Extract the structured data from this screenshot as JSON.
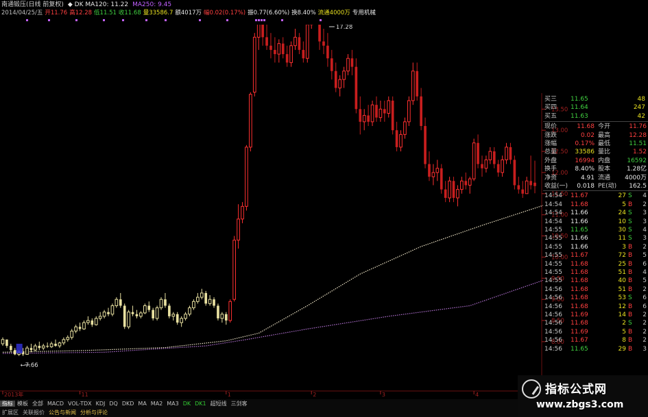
{
  "header": {
    "title_parts": [
      {
        "text": "南通锻压(日线 前复权)",
        "color": "#d0d0d0"
      },
      {
        "text": "◆ DK  MA120: 11.22",
        "color": "#e8e8e8"
      },
      {
        "text": "MA250: 9.45",
        "color": "#c060ff"
      }
    ],
    "quote_parts": [
      {
        "text": "2014/04/25/五",
        "color": "#c0c0c0"
      },
      {
        "text": "开11.76",
        "color": "#ff4040"
      },
      {
        "text": "高12.28",
        "color": "#ff4040"
      },
      {
        "text": "低11.51",
        "color": "#40d040"
      },
      {
        "text": "收11.68",
        "color": "#40d040"
      },
      {
        "text": "量33586.7",
        "color": "#e8e020"
      },
      {
        "text": "额4017万",
        "color": "#e8e8e8"
      },
      {
        "text": "幅0.02(0.17%)",
        "color": "#ff4040"
      },
      {
        "text": "振0.77(6.60%)",
        "color": "#e8e8e8"
      },
      {
        "text": "换8.40%",
        "color": "#e8e8e8"
      },
      {
        "text": "流通4000万",
        "color": "#e8e020"
      },
      {
        "text": "专用机械",
        "color": "#e8e8e8"
      }
    ]
  },
  "chart_data": {
    "type": "candlestick",
    "title": "南通锻压(日线 前复权)",
    "ylim": [
      7.4,
      15.4
    ],
    "y_ticks": [
      "15.00",
      "14.50",
      "14.00",
      "13.50",
      "13.00",
      "12.50",
      "12.00",
      "11.50",
      "11.00",
      "10.50",
      "10.00",
      "9.50",
      "9.00",
      "8.50",
      "8.00"
    ],
    "x_ticks": [
      {
        "label": "2013年",
        "idx": 0
      },
      {
        "label": "11",
        "idx": 19
      },
      {
        "label": "1",
        "idx": 55
      },
      {
        "label": "2",
        "idx": 76
      },
      {
        "label": "3",
        "idx": 93
      },
      {
        "label": "4",
        "idx": 116
      }
    ],
    "annotations": [
      {
        "text": "17.28",
        "idx": 80,
        "value": 15.4
      },
      {
        "text": "7.66",
        "idx": 5,
        "value": 7.66
      }
    ],
    "ma_series": [
      {
        "name": "MA120",
        "color": "#f0e6c8",
        "points": [
          [
            0,
            7.75
          ],
          [
            20,
            7.79
          ],
          [
            40,
            7.86
          ],
          [
            55,
            8.02
          ],
          [
            63,
            8.2
          ],
          [
            75,
            8.85
          ],
          [
            88,
            9.6
          ],
          [
            103,
            10.25
          ],
          [
            118,
            10.75
          ],
          [
            133,
            11.22
          ]
        ]
      },
      {
        "name": "MA250",
        "color": "#b070d0",
        "points": [
          [
            0,
            7.72
          ],
          [
            25,
            7.75
          ],
          [
            50,
            7.9
          ],
          [
            60,
            8.05
          ],
          [
            75,
            8.3
          ],
          [
            95,
            8.6
          ],
          [
            115,
            8.85
          ],
          [
            133,
            9.45
          ]
        ]
      }
    ],
    "candles": [
      [
        7.95,
        8.1,
        7.9,
        8.05
      ],
      [
        8.05,
        8.05,
        7.85,
        7.9
      ],
      [
        7.9,
        7.95,
        7.75,
        7.8
      ],
      [
        7.8,
        7.85,
        7.68,
        7.7
      ],
      [
        7.7,
        7.8,
        7.66,
        7.75
      ],
      [
        7.75,
        7.85,
        7.66,
        7.7
      ],
      [
        7.7,
        7.9,
        7.7,
        7.85
      ],
      [
        7.85,
        7.95,
        7.75,
        7.8
      ],
      [
        7.8,
        7.95,
        7.78,
        7.9
      ],
      [
        7.9,
        8.0,
        7.8,
        7.85
      ],
      [
        7.85,
        7.95,
        7.8,
        7.9
      ],
      [
        7.9,
        7.98,
        7.85,
        7.88
      ],
      [
        7.88,
        8.0,
        7.85,
        7.95
      ],
      [
        7.95,
        8.05,
        7.88,
        7.9
      ],
      [
        7.9,
        8.0,
        7.85,
        7.97
      ],
      [
        7.97,
        8.1,
        7.92,
        8.05
      ],
      [
        8.05,
        8.15,
        8.0,
        8.1
      ],
      [
        8.1,
        8.3,
        8.05,
        8.25
      ],
      [
        8.25,
        8.4,
        8.2,
        8.35
      ],
      [
        8.35,
        8.45,
        8.25,
        8.3
      ],
      [
        8.3,
        8.5,
        8.28,
        8.45
      ],
      [
        8.45,
        8.6,
        8.4,
        8.5
      ],
      [
        8.5,
        8.55,
        8.35,
        8.4
      ],
      [
        8.4,
        8.6,
        8.38,
        8.55
      ],
      [
        8.55,
        8.7,
        8.5,
        8.6
      ],
      [
        8.6,
        8.75,
        8.55,
        8.7
      ],
      [
        8.7,
        8.8,
        8.6,
        8.65
      ],
      [
        8.65,
        8.9,
        8.6,
        8.85
      ],
      [
        8.85,
        9.05,
        8.8,
        9.0
      ],
      [
        9.0,
        9.15,
        8.8,
        8.85
      ],
      [
        8.85,
        8.9,
        8.3,
        8.35
      ],
      [
        8.35,
        8.75,
        8.3,
        8.7
      ],
      [
        8.7,
        8.85,
        8.6,
        8.65
      ],
      [
        8.65,
        8.75,
        8.55,
        8.6
      ],
      [
        8.6,
        8.72,
        8.55,
        8.68
      ],
      [
        8.68,
        8.9,
        8.65,
        8.85
      ],
      [
        8.85,
        8.95,
        8.7,
        8.75
      ],
      [
        8.75,
        8.8,
        8.5,
        8.55
      ],
      [
        8.55,
        8.85,
        8.5,
        8.8
      ],
      [
        8.8,
        9.05,
        8.75,
        9.0
      ],
      [
        9.0,
        9.15,
        8.8,
        8.85
      ],
      [
        8.85,
        8.9,
        8.55,
        8.6
      ],
      [
        8.6,
        8.7,
        8.5,
        8.65
      ],
      [
        8.65,
        8.7,
        8.4,
        8.45
      ],
      [
        8.45,
        8.6,
        8.35,
        8.55
      ],
      [
        8.55,
        8.7,
        8.5,
        8.65
      ],
      [
        8.65,
        8.85,
        8.6,
        8.8
      ],
      [
        8.8,
        9.0,
        8.75,
        8.95
      ],
      [
        8.95,
        9.15,
        8.9,
        9.05
      ],
      [
        9.05,
        9.25,
        9.0,
        9.15
      ],
      [
        9.15,
        9.2,
        8.85,
        8.9
      ],
      [
        8.9,
        9.1,
        8.85,
        9.0
      ],
      [
        9.0,
        9.05,
        8.8,
        8.85
      ],
      [
        8.85,
        8.9,
        8.5,
        8.55
      ],
      [
        8.55,
        8.7,
        8.45,
        8.65
      ],
      [
        8.65,
        8.7,
        8.4,
        8.5
      ],
      [
        8.5,
        9.0,
        8.45,
        8.95
      ],
      [
        9.0,
        10.5,
        8.95,
        10.4
      ],
      [
        10.4,
        11.25,
        10.2,
        10.9
      ],
      [
        10.9,
        11.3,
        10.8,
        11.2
      ],
      [
        11.2,
        12.65,
        11.1,
        12.6
      ],
      [
        12.6,
        13.9,
        12.5,
        13.85
      ],
      [
        13.9,
        15.3,
        13.8,
        15.2
      ],
      [
        15.2,
        16.1,
        14.9,
        15.6
      ],
      [
        15.6,
        15.9,
        15.0,
        15.2
      ],
      [
        15.2,
        15.5,
        14.9,
        15.0
      ],
      [
        15.0,
        15.3,
        14.7,
        14.9
      ],
      [
        14.9,
        15.2,
        14.6,
        14.8
      ],
      [
        14.8,
        15.15,
        14.6,
        15.05
      ],
      [
        15.05,
        15.2,
        14.7,
        14.8
      ],
      [
        14.8,
        15.0,
        14.5,
        14.6
      ],
      [
        14.6,
        15.1,
        14.5,
        15.0
      ],
      [
        15.0,
        15.4,
        14.9,
        15.2
      ],
      [
        15.2,
        15.3,
        14.8,
        14.9
      ],
      [
        14.9,
        15.1,
        14.6,
        14.7
      ],
      [
        14.7,
        15.6,
        14.6,
        15.5
      ],
      [
        15.5,
        17.28,
        15.4,
        17.0
      ],
      [
        17.0,
        17.2,
        16.0,
        16.2
      ],
      [
        16.2,
        16.4,
        14.9,
        15.1
      ],
      [
        15.1,
        15.4,
        14.8,
        15.0
      ],
      [
        15.0,
        15.3,
        14.5,
        14.7
      ],
      [
        14.7,
        14.9,
        14.2,
        14.4
      ],
      [
        14.4,
        14.6,
        13.9,
        14.0
      ],
      [
        14.0,
        14.3,
        13.8,
        14.2
      ],
      [
        14.2,
        14.5,
        14.0,
        14.4
      ],
      [
        14.4,
        14.8,
        14.3,
        14.7
      ],
      [
        14.7,
        14.9,
        14.3,
        14.5
      ],
      [
        14.5,
        14.7,
        13.4,
        13.5
      ],
      [
        13.5,
        13.8,
        12.9,
        13.2
      ],
      [
        13.2,
        13.5,
        13.0,
        13.35
      ],
      [
        13.35,
        13.6,
        13.1,
        13.2
      ],
      [
        13.2,
        13.7,
        13.1,
        13.6
      ],
      [
        13.6,
        13.8,
        13.2,
        13.3
      ],
      [
        13.3,
        13.7,
        13.2,
        13.5
      ],
      [
        13.5,
        13.7,
        13.2,
        13.4
      ],
      [
        13.4,
        13.8,
        13.3,
        13.7
      ],
      [
        13.7,
        13.8,
        12.9,
        13.0
      ],
      [
        13.0,
        13.2,
        12.5,
        12.6
      ],
      [
        12.6,
        13.0,
        12.5,
        12.9
      ],
      [
        12.9,
        13.3,
        12.8,
        13.2
      ],
      [
        13.2,
        13.8,
        13.1,
        13.7
      ],
      [
        13.7,
        14.6,
        13.6,
        14.4
      ],
      [
        14.4,
        14.6,
        13.7,
        13.8
      ],
      [
        13.8,
        14.0,
        13.0,
        13.1
      ],
      [
        13.1,
        13.3,
        12.1,
        12.2
      ],
      [
        12.2,
        12.5,
        11.8,
        11.9
      ],
      [
        11.9,
        12.2,
        11.7,
        12.0
      ],
      [
        12.0,
        12.3,
        11.8,
        12.1
      ],
      [
        12.1,
        12.2,
        11.5,
        11.6
      ],
      [
        11.6,
        11.8,
        11.3,
        11.4
      ],
      [
        11.4,
        11.9,
        11.3,
        11.8
      ],
      [
        11.8,
        11.9,
        11.3,
        11.4
      ],
      [
        11.4,
        11.7,
        11.2,
        11.6
      ],
      [
        11.6,
        11.9,
        11.5,
        11.8
      ],
      [
        11.8,
        12.0,
        11.6,
        11.7
      ],
      [
        11.7,
        11.9,
        11.5,
        11.85
      ],
      [
        11.85,
        12.8,
        11.8,
        12.7
      ],
      [
        12.7,
        12.9,
        12.1,
        12.2
      ],
      [
        12.2,
        12.4,
        11.9,
        12.1
      ],
      [
        12.1,
        12.4,
        12.0,
        12.3
      ],
      [
        12.3,
        12.6,
        12.2,
        12.5
      ],
      [
        12.5,
        12.6,
        12.1,
        12.2
      ],
      [
        12.2,
        12.3,
        11.9,
        12.0
      ],
      [
        12.0,
        12.4,
        11.9,
        12.3
      ],
      [
        12.3,
        12.7,
        12.2,
        12.6
      ],
      [
        12.6,
        12.7,
        12.2,
        12.3
      ],
      [
        12.3,
        12.4,
        11.6,
        11.7
      ],
      [
        11.7,
        11.9,
        11.5,
        11.6
      ],
      [
        11.6,
        11.8,
        11.4,
        11.5
      ],
      [
        11.5,
        11.9,
        11.5,
        11.8
      ],
      [
        11.8,
        12.4,
        11.6,
        11.7
      ],
      [
        11.76,
        12.28,
        11.51,
        11.68
      ]
    ]
  },
  "side_panel": {
    "order_book": [
      {
        "label": "买三",
        "price": "11.65",
        "vol": "48"
      },
      {
        "label": "买四",
        "price": "11.64",
        "vol": "247"
      },
      {
        "label": "买五",
        "price": "11.63",
        "vol": "42"
      }
    ],
    "stats": [
      {
        "l1": "现价",
        "v1": "11.68",
        "c1": "#ff4040",
        "l2": "今开",
        "v2": "11.76",
        "c2": "#ff4040"
      },
      {
        "l1": "涨跌",
        "v1": "0.02",
        "c1": "#ff4040",
        "l2": "最高",
        "v2": "12.28",
        "c2": "#ff4040"
      },
      {
        "l1": "涨幅",
        "v1": "0.17%",
        "c1": "#ff4040",
        "l2": "最低",
        "v2": "11.51",
        "c2": "#40d040"
      },
      {
        "l1": "总量",
        "v1": "33586",
        "c1": "#e8e020",
        "l2": "量比",
        "v2": "1.52",
        "c2": "#ff4040"
      },
      {
        "l1": "外盘",
        "v1": "16994",
        "c1": "#ff4040",
        "l2": "内盘",
        "v2": "16592",
        "c2": "#40d040"
      },
      {
        "l1": "换手",
        "v1": "8.40%",
        "c1": "#e8e8e8",
        "l2": "股本",
        "v2": "1.28亿",
        "c2": "#e8e8e8"
      },
      {
        "l1": "净资",
        "v1": "4.91",
        "c1": "#e8e8e8",
        "l2": "流通",
        "v2": "4000万",
        "c2": "#e8e8e8"
      },
      {
        "l1": "收益(一)",
        "v1": "0.018",
        "c1": "#e8e8e8",
        "l2": "PE(动)",
        "v2": "162.5",
        "c2": "#e8e8e8"
      }
    ],
    "ticks": [
      {
        "time": "14:54",
        "price": "11.67",
        "pc": "#ff4040",
        "vol": "27",
        "side": "S",
        "n": "4"
      },
      {
        "time": "14:54",
        "price": "11.68",
        "pc": "#ff4040",
        "vol": "5",
        "side": "B",
        "n": "2"
      },
      {
        "time": "14:54",
        "price": "11.66",
        "pc": "#e8e8e8",
        "vol": "24",
        "side": "S",
        "n": "3"
      },
      {
        "time": "14:54",
        "price": "11.66",
        "pc": "#e8e8e8",
        "vol": "10",
        "side": "S",
        "n": "3"
      },
      {
        "time": "14:55",
        "price": "11.65",
        "pc": "#40d040",
        "vol": "30",
        "side": "S",
        "n": "4"
      },
      {
        "time": "14:55",
        "price": "11.66",
        "pc": "#e8e8e8",
        "vol": "11",
        "side": "S",
        "n": "3"
      },
      {
        "time": "14:55",
        "price": "11.66",
        "pc": "#e8e8e8",
        "vol": "3",
        "side": "B",
        "n": "2"
      },
      {
        "time": "14:55",
        "price": "11.67",
        "pc": "#ff4040",
        "vol": "72",
        "side": "B",
        "n": "5"
      },
      {
        "time": "14:55",
        "price": "11.68",
        "pc": "#ff4040",
        "vol": "25",
        "side": "B",
        "n": "6"
      },
      {
        "time": "14:55",
        "price": "11.68",
        "pc": "#ff4040",
        "vol": "51",
        "side": "B",
        "n": "4"
      },
      {
        "time": "14:55",
        "price": "11.68",
        "pc": "#ff4040",
        "vol": "40",
        "side": "B",
        "n": "5"
      },
      {
        "time": "14:56",
        "price": "11.68",
        "pc": "#ff4040",
        "vol": "51",
        "side": "B",
        "n": "2"
      },
      {
        "time": "14:56",
        "price": "11.68",
        "pc": "#ff4040",
        "vol": "53",
        "side": "S",
        "n": "6"
      },
      {
        "time": "14:56",
        "price": "11.68",
        "pc": "#ff4040",
        "vol": "12",
        "side": "B",
        "n": "6"
      },
      {
        "time": "14:56",
        "price": "11.69",
        "pc": "#ff4040",
        "vol": "14",
        "side": "B",
        "n": "2"
      },
      {
        "time": "14:56",
        "price": "11.68",
        "pc": "#ff4040",
        "vol": "2",
        "side": "S",
        "n": "2"
      },
      {
        "time": "14:56",
        "price": "11.69",
        "pc": "#ff4040",
        "vol": "5",
        "side": "B",
        "n": "2"
      },
      {
        "time": "14:56",
        "price": "11.67",
        "pc": "#ff4040",
        "vol": "8",
        "side": "B",
        "n": "2"
      },
      {
        "time": "14:56",
        "price": "11.65",
        "pc": "#40d040",
        "vol": "29",
        "side": "B",
        "n": "3"
      }
    ]
  },
  "bottom_tabs_row1": [
    "指标",
    "模板",
    "全部",
    "MACD",
    "VOL-TDX",
    "KDJ",
    "DQ",
    "DKD",
    "MA",
    "MA2",
    "MA3",
    "DK",
    "DK1",
    "超短线",
    "三剑客"
  ],
  "bottom_tabs_row2": [
    "扩展区",
    "关联报价",
    "公告与新闻",
    "分析与评论"
  ],
  "watermark": {
    "line1": "指标公式网",
    "line2": "www.zbgs3.com"
  }
}
